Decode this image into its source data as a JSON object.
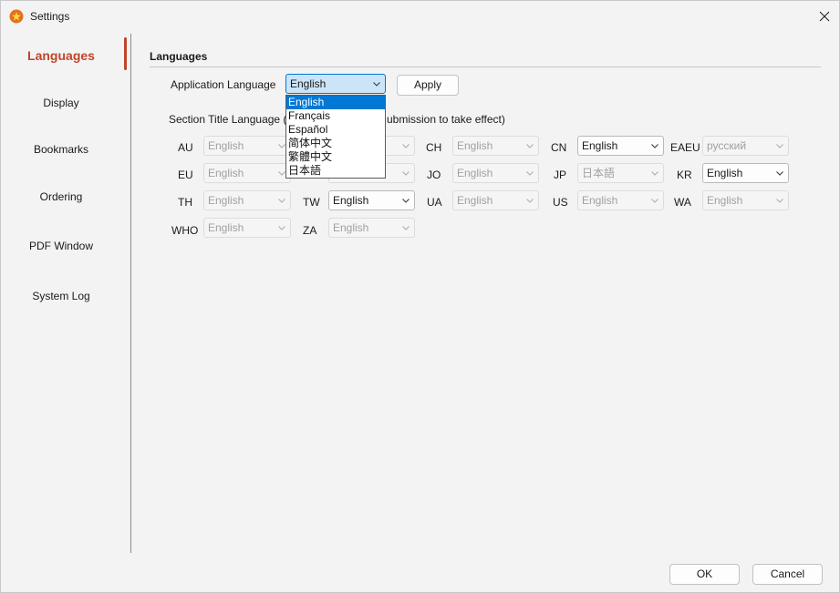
{
  "window": {
    "title": "Settings"
  },
  "sidebar": {
    "items": [
      {
        "label": "Languages",
        "active": true
      },
      {
        "label": "Display"
      },
      {
        "label": "Bookmarks"
      },
      {
        "label": "Ordering"
      },
      {
        "label": "PDF Window"
      },
      {
        "label": "System Log"
      }
    ]
  },
  "languages": {
    "section_title": "Languages",
    "app_language_label": "Application Language",
    "app_language_value": "English",
    "apply_label": "Apply",
    "hint_visible_left": "Section Title Language (",
    "hint_visible_right": "ubmission to take effect)",
    "dropdown_options": [
      {
        "label": "English",
        "selected": true
      },
      {
        "label": "Français"
      },
      {
        "label": "Español"
      },
      {
        "label": "简体中文"
      },
      {
        "label": "繁體中文"
      },
      {
        "label": "日本語"
      }
    ],
    "regions": [
      {
        "code": "AU",
        "value": "English",
        "enabled": false
      },
      {
        "code": "CH",
        "value": "English",
        "enabled": false
      },
      {
        "code": "CN",
        "value": "English",
        "enabled": true
      },
      {
        "code": "EAEU",
        "value": "русский",
        "enabled": false
      },
      {
        "code": "EU",
        "value": "English",
        "enabled": false
      },
      {
        "code": "JO",
        "value": "English",
        "enabled": false
      },
      {
        "code": "JP",
        "value": "日本語",
        "enabled": false
      },
      {
        "code": "KR",
        "value": "English",
        "enabled": true
      },
      {
        "code": "TH",
        "value": "English",
        "enabled": false
      },
      {
        "code": "TW",
        "value": "English",
        "enabled": true
      },
      {
        "code": "UA",
        "value": "English",
        "enabled": false
      },
      {
        "code": "US",
        "value": "English",
        "enabled": false
      },
      {
        "code": "WA",
        "value": "English",
        "enabled": false
      },
      {
        "code": "WHO",
        "value": "English",
        "enabled": false
      },
      {
        "code": "ZA",
        "value": "English",
        "enabled": false
      }
    ]
  },
  "footer": {
    "ok_label": "OK",
    "cancel_label": "Cancel"
  },
  "colors": {
    "accent": "#c0442a",
    "selection": "#0078d4"
  }
}
